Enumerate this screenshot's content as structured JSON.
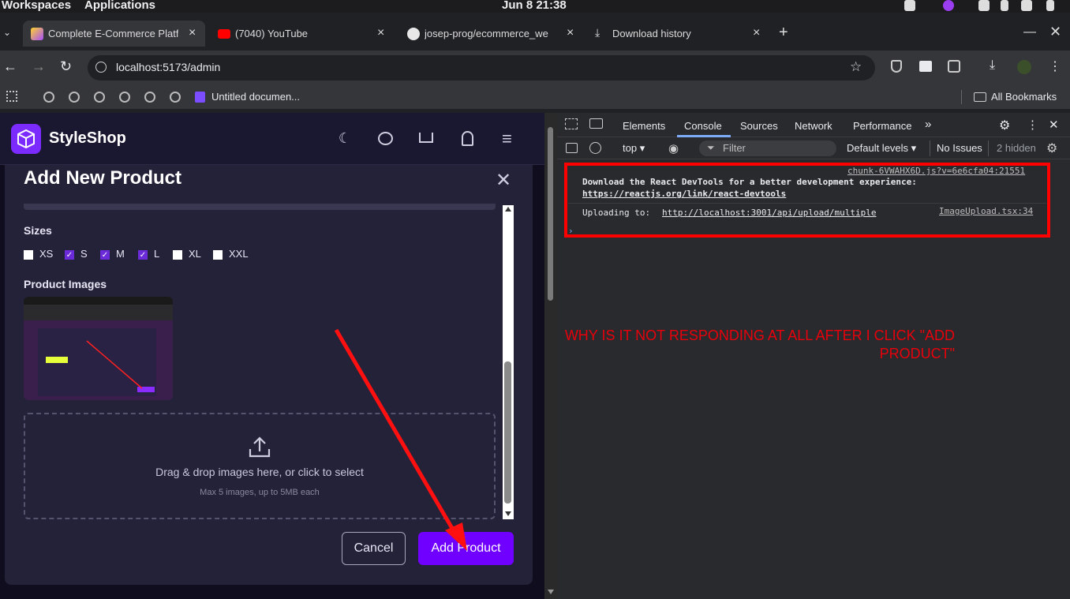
{
  "system": {
    "workspaces": "Workspaces",
    "applications": "Applications",
    "clock": "Jun 8  21:38"
  },
  "tabs": [
    {
      "title": "Complete E-Commerce Platfo",
      "icon": "vite-icon"
    },
    {
      "title": "(7040) YouTube",
      "icon": "youtube-icon"
    },
    {
      "title": "josep-prog/ecommerce_we",
      "icon": "github-icon"
    },
    {
      "title": "Download history",
      "icon": "download-icon"
    }
  ],
  "address": {
    "url": "localhost:5173/admin"
  },
  "bookmarks": {
    "doc": "Untitled documen...",
    "all": "All Bookmarks"
  },
  "app": {
    "brand": "StyleShop",
    "modal": {
      "title": "Add New Product",
      "sizes_label": "Sizes",
      "sizes": [
        {
          "label": "XS",
          "checked": false
        },
        {
          "label": "S",
          "checked": true
        },
        {
          "label": "M",
          "checked": true
        },
        {
          "label": "L",
          "checked": true
        },
        {
          "label": "XL",
          "checked": false
        },
        {
          "label": "XXL",
          "checked": false
        }
      ],
      "images_label": "Product Images",
      "drop_text": "Drag & drop images here, or click to select",
      "drop_sub": "Max 5 images, up to 5MB each",
      "cancel": "Cancel",
      "submit": "Add Product"
    }
  },
  "devtools": {
    "tabs": [
      "Elements",
      "Console",
      "Sources",
      "Network",
      "Performance"
    ],
    "context": "top",
    "filter_placeholder": "Filter",
    "levels": "Default levels",
    "issues": "No Issues",
    "hidden": "2 hidden",
    "messages": [
      {
        "source": "chunk-6VWAHX6D.js?v=6e6cfa04:21551",
        "text": "Download the React DevTools for a better development experience:",
        "link": "https://reactjs.org/link/react-devtools"
      },
      {
        "source": "ImageUpload.tsx:34",
        "text": "Uploading to:",
        "link": "http://localhost:3001/api/upload/multiple"
      }
    ],
    "prompt": "›"
  },
  "annotation": "WHY IS IT NOT RESPONDING AT ALL AFTER I CLICK \"ADD PRODUCT\""
}
